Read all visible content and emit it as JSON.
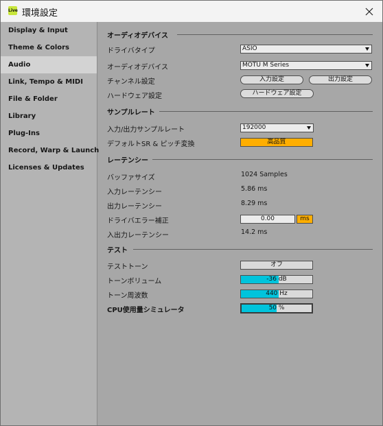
{
  "window": {
    "app_icon_text": "Live",
    "title": "環境設定"
  },
  "sidebar": {
    "items": [
      {
        "label": "Display & Input"
      },
      {
        "label": "Theme & Colors"
      },
      {
        "label": "Audio",
        "active": true
      },
      {
        "label": "Link, Tempo & MIDI"
      },
      {
        "label": "File & Folder"
      },
      {
        "label": "Library"
      },
      {
        "label": "Plug-Ins"
      },
      {
        "label": "Record, Warp & Launch"
      },
      {
        "label": "Licenses & Updates"
      }
    ]
  },
  "audio_device": {
    "heading": "オーディオデバイス",
    "driver_type_label": "ドライバタイプ",
    "driver_type_value": "ASIO",
    "device_label": "オーディオデバイス",
    "device_value": "MOTU M Series",
    "channel_label": "チャンネル設定",
    "input_config_button": "入力設定",
    "output_config_button": "出力設定",
    "hardware_label": "ハードウェア設定",
    "hardware_button": "ハードウェア設定"
  },
  "sample_rate": {
    "heading": "サンプルレート",
    "rate_label": "入力/出力サンプルレート",
    "rate_value": "192000",
    "conversion_label": "デフォルトSR & ピッチ変換",
    "conversion_value": "高品質"
  },
  "latency": {
    "heading": "レーテンシー",
    "buffer_label": "バッファサイズ",
    "buffer_value": "1024 Samples",
    "input_label": "入力レーテンシー",
    "input_value": "5.86 ms",
    "output_label": "出力レーテンシー",
    "output_value": "8.29 ms",
    "driver_error_label": "ドライバエラー補正",
    "driver_error_value": "0.00",
    "driver_error_unit": "ms",
    "overall_label": "入出力レーテンシー",
    "overall_value": "14.2 ms"
  },
  "test": {
    "heading": "テスト",
    "tone_label": "テストトーン",
    "tone_value": "オフ",
    "volume_label": "トーンボリューム",
    "volume_value": "-36 dB",
    "volume_fill": 0.53,
    "frequency_label": "トーン周波数",
    "frequency_value": "440 Hz",
    "frequency_fill": 0.53,
    "cpu_label": "CPU使用量シミュレータ",
    "cpu_value": "50 %",
    "cpu_fill": 0.5
  },
  "colors": {
    "accent_cyan": "#00c4dc",
    "accent_orange": "#ffae00",
    "panel_bg": "#a7a7a7",
    "sidebar_bg": "#b4b4b4",
    "sidebar_active": "#d3d3d3"
  }
}
